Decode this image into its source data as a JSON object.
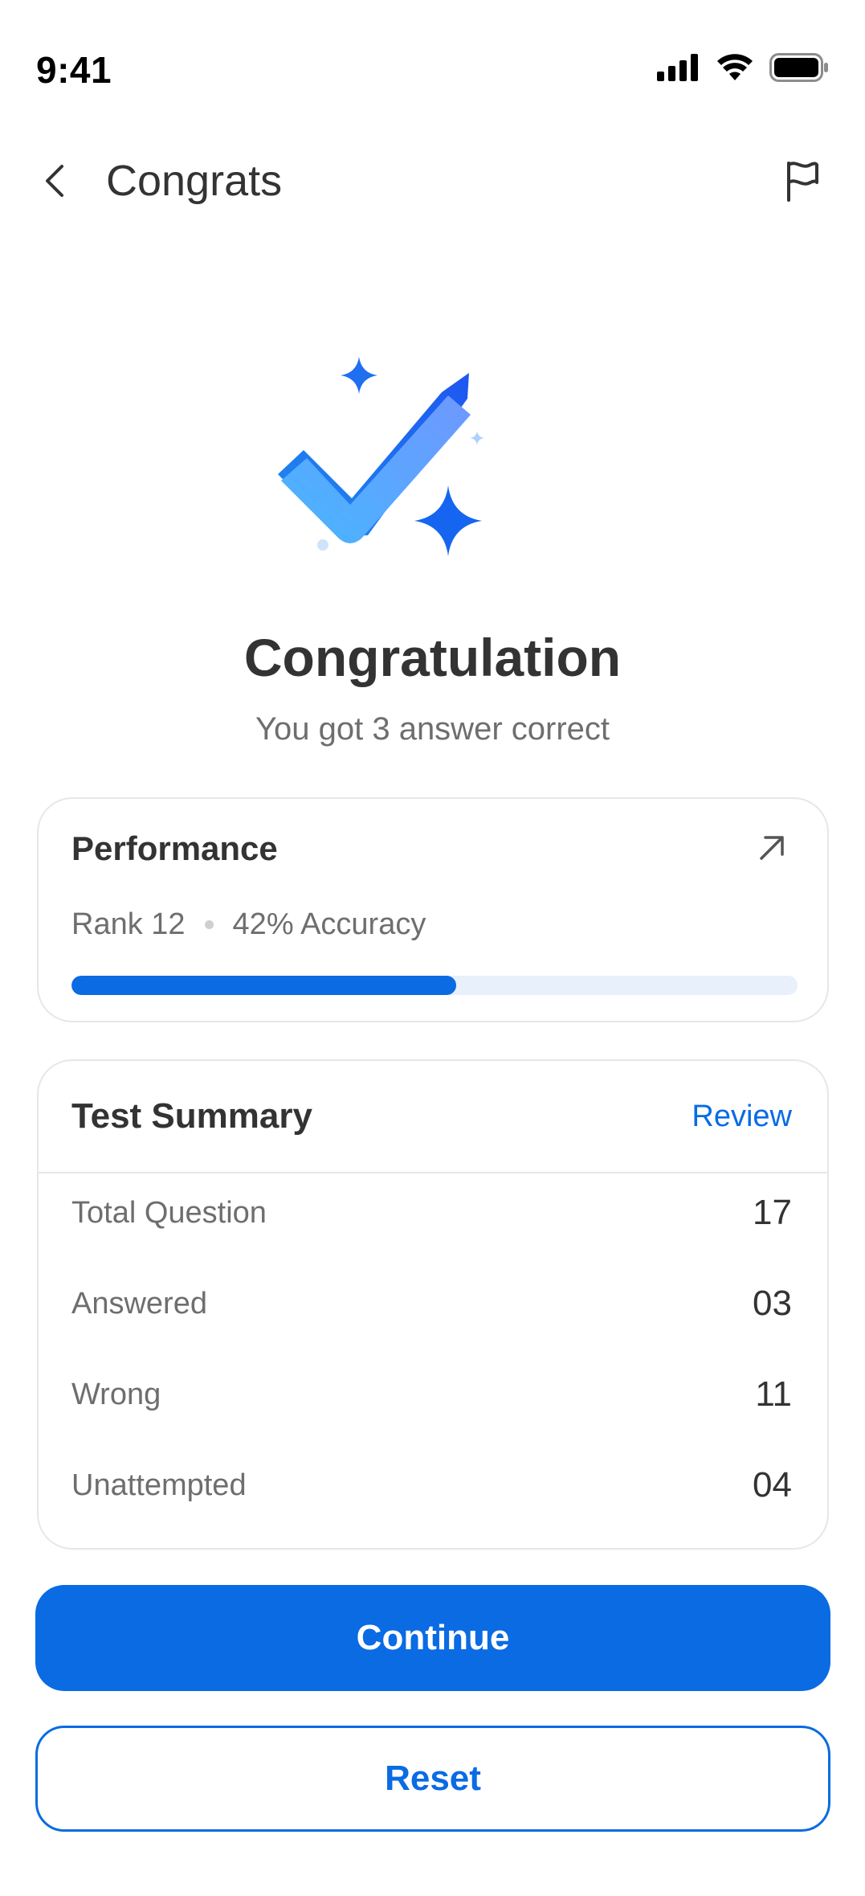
{
  "status_bar": {
    "time": "9:41",
    "icons": [
      "cellular-signal-icon",
      "wifi-icon",
      "battery-icon"
    ]
  },
  "header": {
    "title": "Congrats",
    "back_icon": "chevron-left-icon",
    "action_icon": "flag-icon"
  },
  "hero": {
    "illustration": "checkmark-icon",
    "title": "Congratulation",
    "subtitle": "You got 3 answer correct"
  },
  "performance": {
    "title": "Performance",
    "action_icon": "arrow-up-right-icon",
    "rank": "Rank 12",
    "accuracy": "42% Accuracy",
    "progress_fraction": 0.53
  },
  "summary": {
    "title": "Test Summary",
    "review_label": "Review",
    "rows": [
      {
        "label": "Total Question",
        "value": "17"
      },
      {
        "label": "Answered",
        "value": "03"
      },
      {
        "label": "Wrong",
        "value": "11"
      },
      {
        "label": "Unattempted",
        "value": "04"
      }
    ]
  },
  "actions": {
    "continue_label": "Continue",
    "reset_label": "Reset"
  },
  "colors": {
    "primary": "#0a6be3",
    "progress_track": "#e8f0fc",
    "text_dark": "#333333",
    "text_muted": "#6e6e6e"
  }
}
